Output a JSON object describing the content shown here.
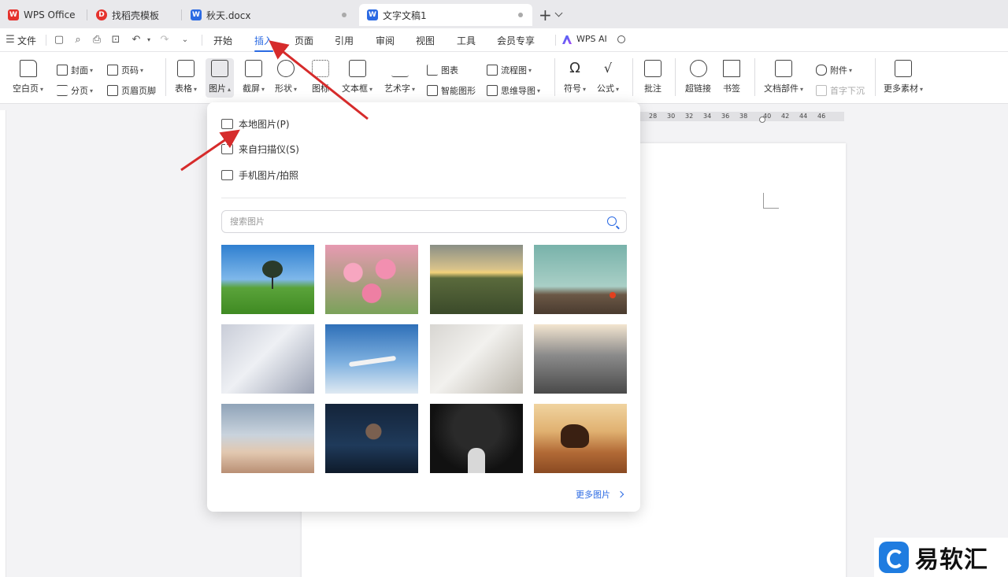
{
  "tabs": [
    {
      "label": "WPS Office",
      "color": "#e5322d",
      "glyph": "W"
    },
    {
      "label": "找稻壳模板",
      "color": "#e5322d",
      "glyph": "D"
    },
    {
      "label": "秋天.docx",
      "color": "#2b6ae3",
      "glyph": "W"
    },
    {
      "label": "文字文稿1",
      "color": "#2b6ae3",
      "glyph": "W",
      "active": true
    }
  ],
  "menu": {
    "file": "文件",
    "items": [
      "开始",
      "插入",
      "页面",
      "引用",
      "审阅",
      "视图",
      "工具",
      "会员专享"
    ],
    "active": "插入",
    "wps_ai": "WPS AI"
  },
  "ribbon": {
    "blank_page": "空白页",
    "cover": "封面",
    "page_break": "分页",
    "page_number": "页码",
    "header_footer": "页眉页脚",
    "table": "表格",
    "picture": "图片",
    "screenshot": "截屏",
    "shape": "形状",
    "icon": "图标",
    "textbox": "文本框",
    "wordart": "艺术字",
    "chart": "图表",
    "smart_graphic": "智能图形",
    "flowchart": "流程图",
    "mindmap": "思维导图",
    "symbol": "符号",
    "formula": "公式",
    "comment": "批注",
    "hyperlink": "超链接",
    "bookmark": "书签",
    "doc_parts": "文档部件",
    "attachment": "附件",
    "drop_cap": "首字下沉",
    "more_materials": "更多素材"
  },
  "ruler": {
    "ticks": [
      "28",
      "30",
      "32",
      "34",
      "36",
      "38",
      "40",
      "42",
      "44",
      "46"
    ]
  },
  "picture_menu": {
    "local": "本地图片(P)",
    "scanner": "来自扫描仪(S)",
    "phone": "手机图片/拍照",
    "search_placeholder": "搜索图片",
    "more": "更多图片"
  },
  "watermark": {
    "text": "易软汇"
  },
  "colors": {
    "accent": "#2b6ae3",
    "arrow": "#d62b2b"
  }
}
